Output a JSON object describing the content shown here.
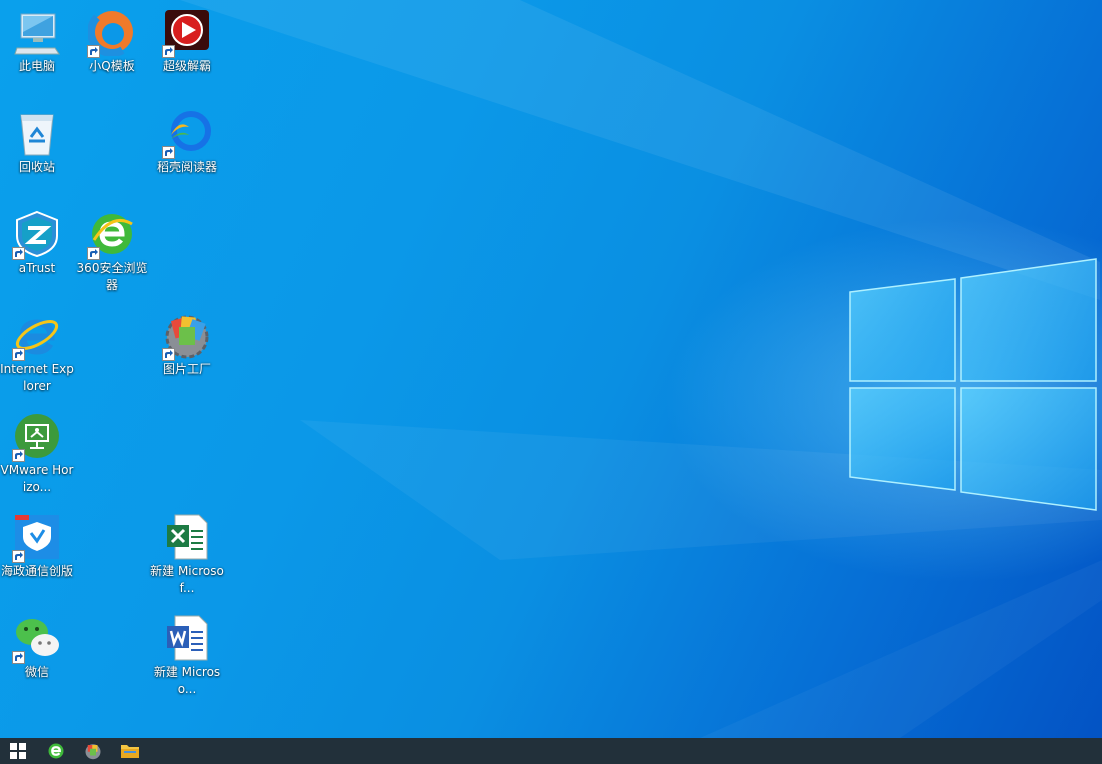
{
  "desktop": {
    "icons": [
      {
        "label": "此电脑",
        "icon": "this-pc-icon",
        "shortcut": false
      },
      {
        "label": "小Q模板",
        "icon": "xiaoq-template-icon",
        "shortcut": true
      },
      {
        "label": "超级解霸",
        "icon": "super-player-icon",
        "shortcut": true
      },
      {
        "label": "回收站",
        "icon": "recycle-bin-icon",
        "shortcut": false
      },
      {
        "label": "稻壳阅读器",
        "icon": "docer-reader-icon",
        "shortcut": true
      },
      {
        "label": "aTrust",
        "icon": "atrust-icon",
        "shortcut": true
      },
      {
        "label": "360安全浏览器",
        "icon": "360-browser-icon",
        "shortcut": true
      },
      {
        "label": "Internet Explorer",
        "icon": "internet-explorer-icon",
        "shortcut": true
      },
      {
        "label": "图片工厂",
        "icon": "picture-factory-icon",
        "shortcut": true
      },
      {
        "label": "VMware Horizo...",
        "icon": "vmware-horizon-icon",
        "shortcut": true
      },
      {
        "label": "海政通信创版",
        "icon": "haizhengtong-icon",
        "shortcut": true
      },
      {
        "label": "新建 Microsof...",
        "icon": "excel-file-icon",
        "shortcut": false
      },
      {
        "label": "微信",
        "icon": "wechat-icon",
        "shortcut": true
      },
      {
        "label": "新建 Microso...",
        "icon": "word-file-icon",
        "shortcut": false
      }
    ]
  },
  "taskbar": {
    "items": [
      {
        "icon": "windows-start-icon"
      },
      {
        "icon": "360-browser-taskbar-icon"
      },
      {
        "icon": "picture-factory-taskbar-icon"
      },
      {
        "icon": "file-explorer-icon"
      }
    ]
  },
  "colors": {
    "desktop_blue": "#0a95e6",
    "taskbar": "#22303a"
  }
}
